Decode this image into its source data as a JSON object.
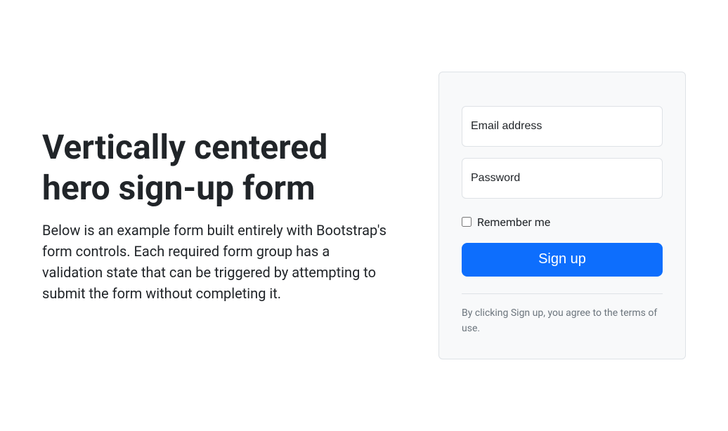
{
  "hero": {
    "heading": "Vertically centered hero sign-up form",
    "description": "Below is an example form built entirely with Bootstrap's form controls. Each required form group has a validation state that can be triggered by attempting to submit the form without completing it."
  },
  "form": {
    "email_placeholder": "Email address",
    "password_placeholder": "Password",
    "remember_label": "Remember me",
    "signup_button_label": "Sign up",
    "terms_text": "By clicking Sign up, you agree to the terms of use."
  }
}
